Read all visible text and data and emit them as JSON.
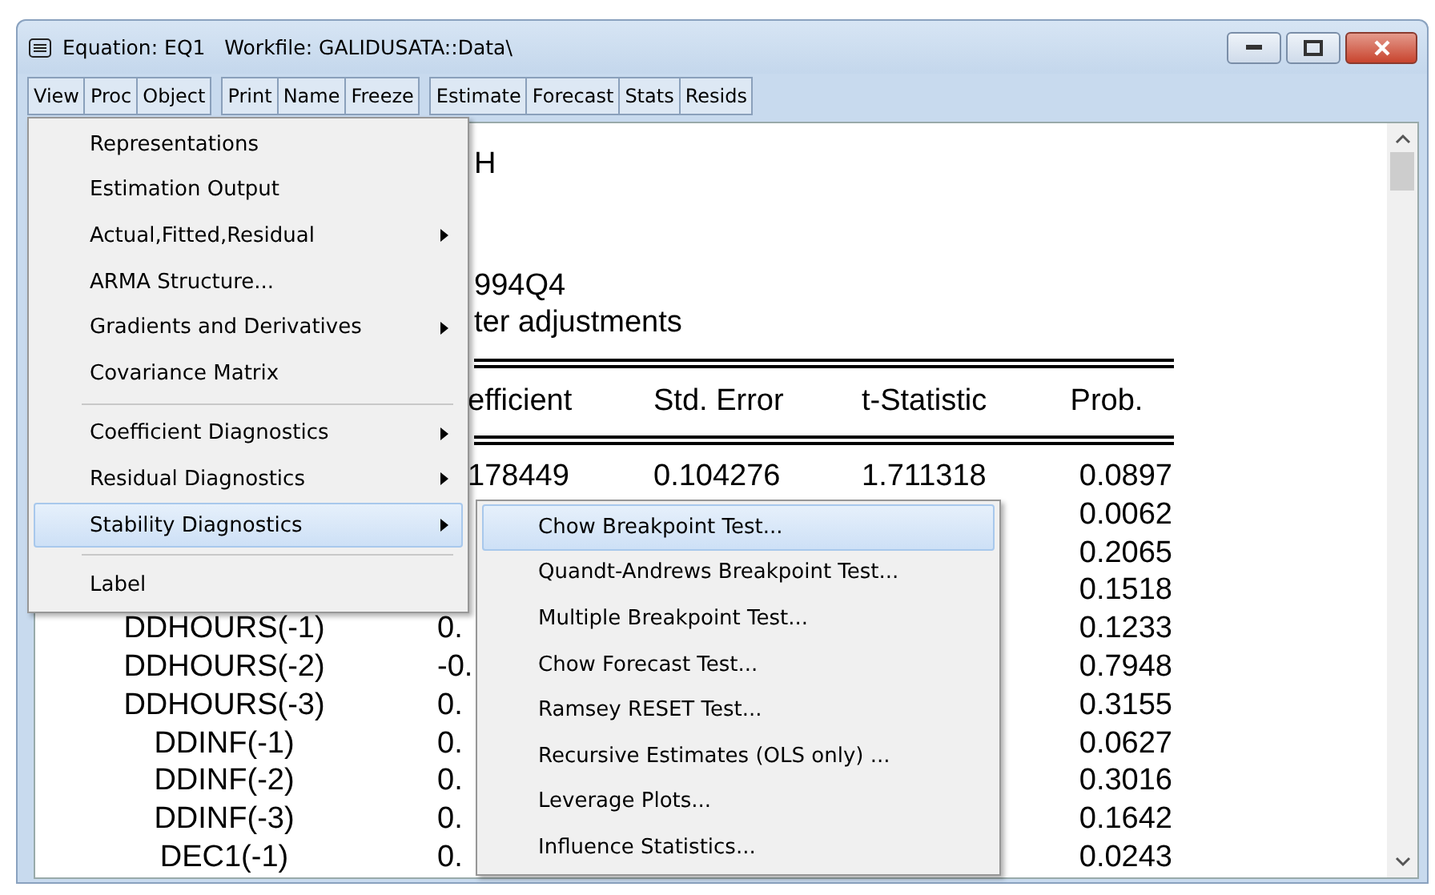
{
  "window": {
    "title": "Equation: EQ1   Workfile: GALIDUSATA::Data\\"
  },
  "toolbar": [
    [
      "View",
      "Proc",
      "Object"
    ],
    [
      "Print",
      "Name",
      "Freeze"
    ],
    [
      "Estimate",
      "Forecast",
      "Stats",
      "Resids"
    ]
  ],
  "output": {
    "lines": [
      "H",
      "994Q4",
      "ter adjustments"
    ],
    "columns": [
      "efficient",
      "Std. Error",
      "t-Statistic",
      "Prob."
    ],
    "rows": [
      {
        "coefficient": "178449",
        "std_error": "0.104276",
        "t_statistic": "1.711318",
        "prob": "0.0897"
      },
      {
        "prob": "0.0062"
      },
      {
        "prob": "0.2065"
      },
      {
        "prob": "0.1518"
      },
      {
        "name": "DDHOURS(-1)",
        "coefficient": "0.",
        "prob": "0.1233"
      },
      {
        "name": "DDHOURS(-2)",
        "coefficient": "-0.",
        "prob": "0.7948"
      },
      {
        "name": "DDHOURS(-3)",
        "coefficient": "0.",
        "prob": "0.3155"
      },
      {
        "name": "DDINF(-1)",
        "coefficient": "0.",
        "prob": "0.0627"
      },
      {
        "name": "DDINF(-2)",
        "coefficient": "0.",
        "prob": "0.3016"
      },
      {
        "name": "DDINF(-3)",
        "coefficient": "0.",
        "prob": "0.1642"
      },
      {
        "name": "DEC1(-1)",
        "coefficient": "0.",
        "prob": "0.0243"
      }
    ]
  },
  "menu": [
    {
      "kind": "item",
      "label": "Representations",
      "submenu": false,
      "selected": false
    },
    {
      "kind": "item",
      "label": "Estimation Output",
      "submenu": false,
      "selected": false
    },
    {
      "kind": "item",
      "label": "Actual,Fitted,Residual",
      "submenu": true,
      "selected": false
    },
    {
      "kind": "item",
      "label": "ARMA Structure...",
      "submenu": false,
      "selected": false
    },
    {
      "kind": "item",
      "label": "Gradients and Derivatives",
      "submenu": true,
      "selected": false
    },
    {
      "kind": "item",
      "label": "Covariance Matrix",
      "submenu": false,
      "selected": false
    },
    {
      "kind": "separator"
    },
    {
      "kind": "item",
      "label": "Coefficient Diagnostics",
      "submenu": true,
      "selected": false
    },
    {
      "kind": "item",
      "label": "Residual Diagnostics",
      "submenu": true,
      "selected": false
    },
    {
      "kind": "item",
      "label": "Stability Diagnostics",
      "submenu": true,
      "selected": true
    },
    {
      "kind": "separator"
    },
    {
      "kind": "item",
      "label": "Label",
      "submenu": false,
      "selected": false
    }
  ],
  "submenu": [
    {
      "label": "Chow Breakpoint Test...",
      "selected": true
    },
    {
      "label": "Quandt-Andrews Breakpoint Test...",
      "selected": false
    },
    {
      "label": "Multiple Breakpoint Test...",
      "selected": false
    },
    {
      "label": "Chow Forecast Test...",
      "selected": false
    },
    {
      "label": "Ramsey RESET Test...",
      "selected": false
    },
    {
      "label": "Recursive Estimates (OLS only) ...",
      "selected": false
    },
    {
      "label": "Leverage Plots...",
      "selected": false
    },
    {
      "label": "Influence Statistics...",
      "selected": false
    }
  ]
}
